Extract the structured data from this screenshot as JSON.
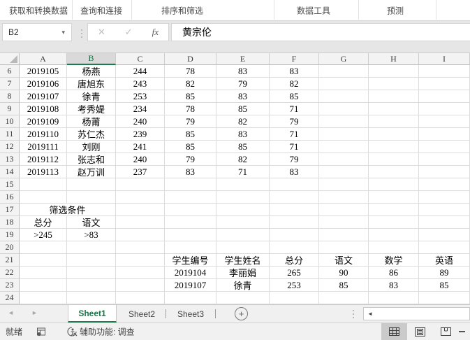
{
  "ribbon": {
    "groups": [
      {
        "label": "获取和转换数据"
      },
      {
        "label": "查询和连接"
      },
      {
        "label": "排序和筛选"
      },
      {
        "label": "数据工具"
      },
      {
        "label": "预测"
      }
    ]
  },
  "formula_bar": {
    "name_box": "B2",
    "value": "黄宗伦"
  },
  "icons": {
    "name_box_dropdown": "▾",
    "cancel": "✕",
    "enter": "✓",
    "function": "fx",
    "tab_nav_left": "◄",
    "tab_nav_right": "►",
    "add_sheet": "+",
    "scroll_left": "◄"
  },
  "grid": {
    "columns": [
      "A",
      "B",
      "C",
      "D",
      "E",
      "F",
      "G",
      "H",
      "I"
    ],
    "selected_column": "B",
    "rows": [
      {
        "n": 6,
        "cells": [
          "2019105",
          "杨燕",
          "244",
          "78",
          "83",
          "83",
          "",
          "",
          ""
        ]
      },
      {
        "n": 7,
        "cells": [
          "2019106",
          "唐旭东",
          "243",
          "82",
          "79",
          "82",
          "",
          "",
          ""
        ]
      },
      {
        "n": 8,
        "cells": [
          "2019107",
          "徐青",
          "253",
          "85",
          "83",
          "85",
          "",
          "",
          ""
        ]
      },
      {
        "n": 9,
        "cells": [
          "2019108",
          "考秀媞",
          "234",
          "78",
          "85",
          "71",
          "",
          "",
          ""
        ]
      },
      {
        "n": 10,
        "cells": [
          "2019109",
          "杨莆",
          "240",
          "79",
          "82",
          "79",
          "",
          "",
          ""
        ]
      },
      {
        "n": 11,
        "cells": [
          "2019110",
          "苏仁杰",
          "239",
          "85",
          "83",
          "71",
          "",
          "",
          ""
        ]
      },
      {
        "n": 12,
        "cells": [
          "2019111",
          "刘刚",
          "241",
          "85",
          "85",
          "71",
          "",
          "",
          ""
        ]
      },
      {
        "n": 13,
        "cells": [
          "2019112",
          "张志和",
          "240",
          "79",
          "82",
          "79",
          "",
          "",
          ""
        ]
      },
      {
        "n": 14,
        "cells": [
          "2019113",
          "赵万训",
          "237",
          "83",
          "71",
          "83",
          "",
          "",
          ""
        ]
      },
      {
        "n": 15,
        "cells": [
          "",
          "",
          "",
          "",
          "",
          "",
          "",
          "",
          ""
        ]
      },
      {
        "n": 16,
        "cells": [
          "",
          "",
          "",
          "",
          "",
          "",
          "",
          "",
          ""
        ]
      },
      {
        "n": 17,
        "cells": [
          "筛选条件",
          "",
          "",
          "",
          "",
          "",
          "",
          "",
          ""
        ],
        "merge_first": 2
      },
      {
        "n": 18,
        "cells": [
          "总分",
          "语文",
          "",
          "",
          "",
          "",
          "",
          "",
          ""
        ]
      },
      {
        "n": 19,
        "cells": [
          ">245",
          ">83",
          "",
          "",
          "",
          "",
          "",
          "",
          ""
        ]
      },
      {
        "n": 20,
        "cells": [
          "",
          "",
          "",
          "",
          "",
          "",
          "",
          "",
          ""
        ]
      },
      {
        "n": 21,
        "cells": [
          "",
          "",
          "",
          "学生编号",
          "学生姓名",
          "总分",
          "语文",
          "数学",
          "英语"
        ]
      },
      {
        "n": 22,
        "cells": [
          "",
          "",
          "",
          "2019104",
          "李丽娟",
          "265",
          "90",
          "86",
          "89"
        ]
      },
      {
        "n": 23,
        "cells": [
          "",
          "",
          "",
          "2019107",
          "徐青",
          "253",
          "85",
          "83",
          "85"
        ]
      },
      {
        "n": 24,
        "cells": [
          "",
          "",
          "",
          "",
          "",
          "",
          "",
          "",
          ""
        ]
      }
    ]
  },
  "sheet_tabs": {
    "tabs": [
      {
        "label": "Sheet1",
        "active": true
      },
      {
        "label": "Sheet2",
        "active": false
      },
      {
        "label": "Sheet3",
        "active": false
      }
    ]
  },
  "status_bar": {
    "ready": "就绪",
    "accessibility": "辅助功能: 调查"
  },
  "colors": {
    "accent_green": "#217346",
    "selected_header_bg": "#d9d9d9",
    "grid_line": "#dcdcdc",
    "active_view_button_bg": "#cacaca"
  }
}
